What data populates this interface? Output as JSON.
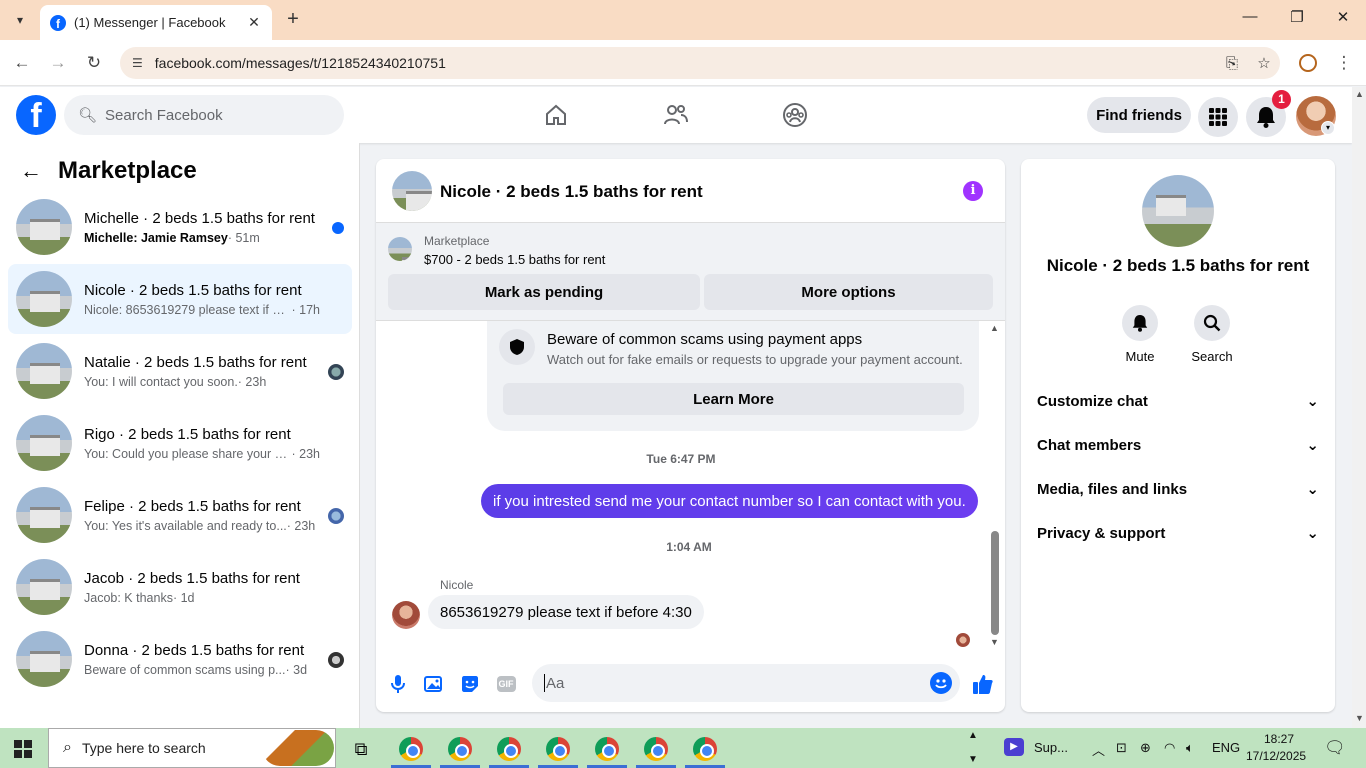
{
  "browser": {
    "tab_title": "(1) Messenger | Facebook",
    "url": "facebook.com/messages/t/1218524340210751"
  },
  "header": {
    "search_placeholder": "Search Facebook",
    "find_friends": "Find friends",
    "notification_count": "1"
  },
  "sidebar": {
    "title": "Marketplace",
    "conversations": [
      {
        "name": "Michelle · 2 beds 1.5 baths for rent",
        "preview": "Michelle: Jamie Ramsey",
        "time": " · 51m",
        "unread": true
      },
      {
        "name": "Nicole · 2 beds 1.5 baths for rent",
        "preview": "Nicole: 8653619279 please text if be...",
        "time": " · 17h",
        "active": true
      },
      {
        "name": "Natalie · 2 beds 1.5 baths for rent",
        "preview": "You: I will contact you soon.",
        "time": " · 23h"
      },
      {
        "name": "Rigo · 2 beds 1.5 baths for rent",
        "preview": "You: Could you please share your co...",
        "time": " · 23h"
      },
      {
        "name": "Felipe · 2 beds 1.5 baths for rent",
        "preview": "You: Yes it's available and ready to...",
        "time": " · 23h"
      },
      {
        "name": "Jacob · 2 beds 1.5 baths for rent",
        "preview": "Jacob: K thanks",
        "time": " · 1d"
      },
      {
        "name": "Donna · 2 beds 1.5 baths for rent",
        "preview": "Beware of common scams using p...",
        "time": " · 3d"
      }
    ]
  },
  "chat": {
    "title": "Nicole · 2 beds 1.5 baths for rent",
    "marketplace_label": "Marketplace",
    "listing": "$700 - 2 beds 1.5 baths for rent",
    "mark_pending": "Mark as pending",
    "more_options": "More options",
    "scam_title": "Beware of common scams using payment apps",
    "scam_subtitle": "Watch out for fake emails or requests to upgrade your payment account.",
    "learn_more": "Learn More",
    "timestamp_1": "Tue 6:47 PM",
    "outgoing_message": "if you intrested send me your contact number so I can contact with you.",
    "timestamp_2": "1:04 AM",
    "sender_name": "Nicole",
    "incoming_message": "8653619279 please text if before 4:30",
    "composer_placeholder": "Aa",
    "gif_label": "GIF"
  },
  "info_panel": {
    "title": "Nicole · 2 beds 1.5 baths for rent",
    "mute": "Mute",
    "search": "Search",
    "sections": [
      "Customize chat",
      "Chat members",
      "Media, files and links",
      "Privacy & support"
    ]
  },
  "taskbar": {
    "search_placeholder": "Type here to search",
    "tray_app": "Sup...",
    "language": "ENG",
    "time": "18:27",
    "date": "17/12/2025"
  },
  "colors": {
    "facebook_blue": "#0866ff",
    "outgoing_bubble": "#5b3de8",
    "notification_red": "#e41e3f",
    "info_purple": "#a033ff"
  }
}
